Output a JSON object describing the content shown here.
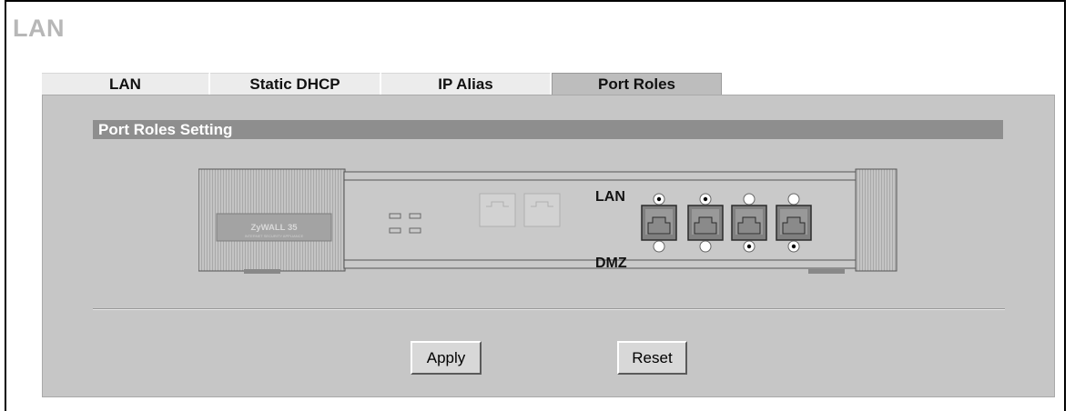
{
  "page": {
    "title": "LAN"
  },
  "tabs": [
    {
      "label": "LAN",
      "active": false
    },
    {
      "label": "Static DHCP",
      "active": false
    },
    {
      "label": "IP Alias",
      "active": false
    },
    {
      "label": "Port Roles",
      "active": true
    }
  ],
  "section": {
    "title": "Port Roles Setting"
  },
  "device": {
    "brand_label": "ZyWALL 35",
    "brand_sub": "INTERNET SECURITY APPLIANCE",
    "row_label_top": "LAN",
    "row_label_bottom": "DMZ",
    "ports": [
      {
        "role": "LAN"
      },
      {
        "role": "LAN"
      },
      {
        "role": "DMZ"
      },
      {
        "role": "DMZ"
      }
    ]
  },
  "buttons": {
    "apply": "Apply",
    "reset": "Reset"
  },
  "colors": {
    "panel": "#c6c6c6",
    "section_header": "#8e8e8e",
    "active_tab": "#bdbdbd",
    "inactive_tab": "#ececec",
    "title": "#b7b7b7"
  }
}
